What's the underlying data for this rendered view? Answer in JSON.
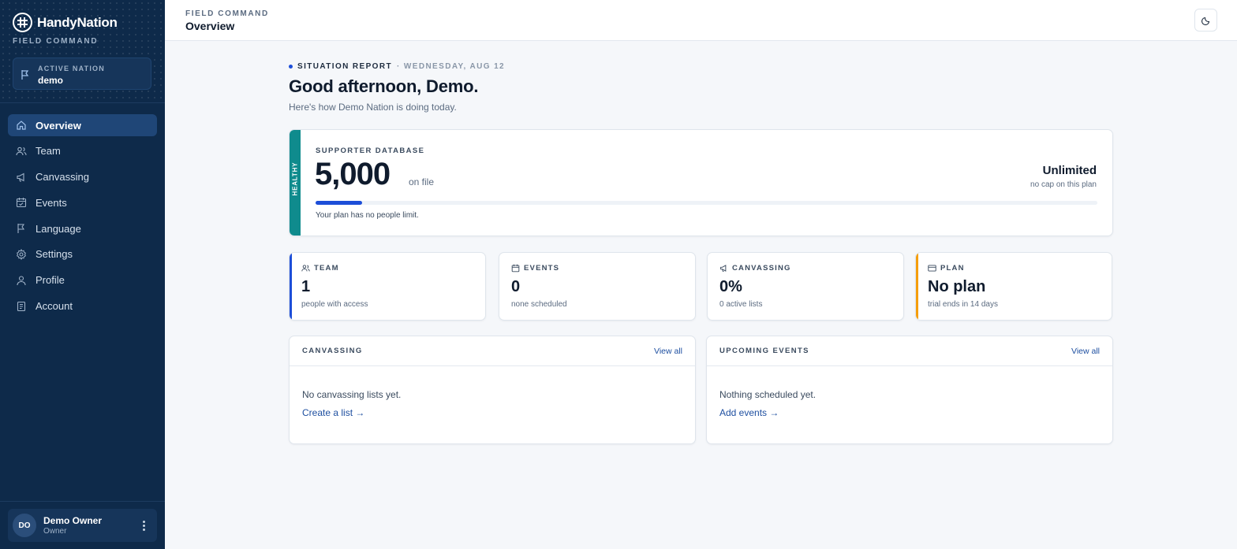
{
  "brand": {
    "name": "HandyNation",
    "sub": "FIELD COMMAND"
  },
  "nation": {
    "label": "ACTIVE NATION",
    "value": "demo"
  },
  "nav": [
    {
      "label": "Overview",
      "icon": "home-icon",
      "active": true
    },
    {
      "label": "Team",
      "icon": "users-icon",
      "active": false
    },
    {
      "label": "Canvassing",
      "icon": "megaphone-icon",
      "active": false
    },
    {
      "label": "Events",
      "icon": "calendar-icon",
      "active": false
    },
    {
      "label": "Language",
      "icon": "flag-icon",
      "active": false
    },
    {
      "label": "Settings",
      "icon": "gear-icon",
      "active": false
    },
    {
      "label": "Profile",
      "icon": "user-icon",
      "active": false
    },
    {
      "label": "Account",
      "icon": "receipt-icon",
      "active": false
    }
  ],
  "user": {
    "initials": "DO",
    "name": "Demo Owner",
    "role": "Owner"
  },
  "header": {
    "kicker": "FIELD COMMAND",
    "title": "Overview"
  },
  "report": {
    "label": "SITUATION REPORT",
    "date": "· WEDNESDAY, AUG 12",
    "greeting": "Good afternoon, Demo.",
    "subtitle": "Here's how Demo Nation is doing today."
  },
  "database": {
    "status": "HEALTHY",
    "kicker": "SUPPORTER DATABASE",
    "count": "5,000",
    "unit": "on file",
    "limit": "Unlimited",
    "limit_sub": "no cap on this plan",
    "progress_fraction": 0.06,
    "note": "Your plan has no people limit."
  },
  "stats": [
    {
      "label": "TEAM",
      "icon": "users-icon",
      "value": "1",
      "sub": "people with access",
      "accent": "#1d4ed8"
    },
    {
      "label": "EVENTS",
      "icon": "calendar-icon",
      "value": "0",
      "sub": "none scheduled",
      "accent": ""
    },
    {
      "label": "CANVASSING",
      "icon": "megaphone-icon",
      "value": "0%",
      "sub": "0 active lists",
      "accent": ""
    },
    {
      "label": "PLAN",
      "icon": "card-icon",
      "value": "No plan",
      "sub": "trial ends in 14 days",
      "accent": "#f59e0b"
    }
  ],
  "panels": {
    "canvassing": {
      "title": "CANVASSING",
      "link": "View all",
      "empty": "No canvassing lists yet.",
      "cta": "Create a list →"
    },
    "events": {
      "title": "UPCOMING EVENTS",
      "link": "View all",
      "empty": "Nothing scheduled yet.",
      "cta": "Add events →"
    }
  },
  "colors": {
    "sidebar": "#0e2a4a",
    "accent": "#1d4ed8",
    "healthy": "#0f8b8d",
    "plan": "#f59e0b"
  }
}
